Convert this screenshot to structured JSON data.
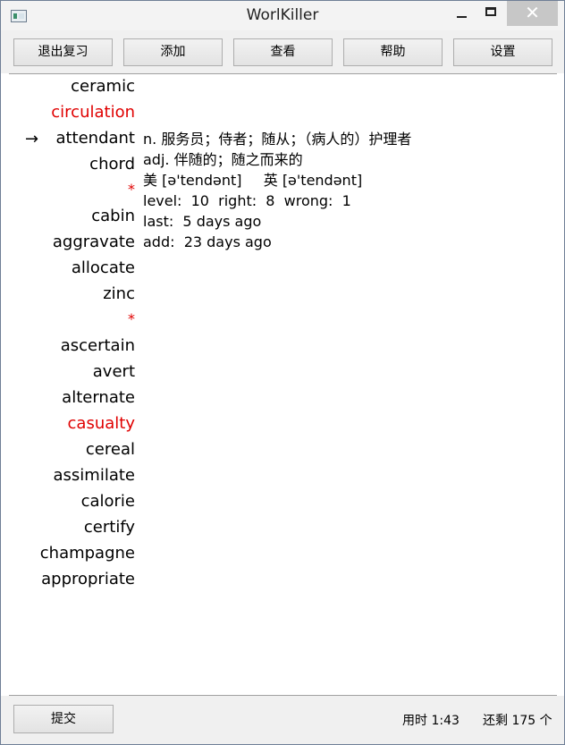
{
  "window": {
    "title": "WorlKiller",
    "close_glyph": "✕"
  },
  "toolbar": {
    "buttons": [
      {
        "label": "退出复习"
      },
      {
        "label": "添加"
      },
      {
        "label": "查看"
      },
      {
        "label": "帮助"
      },
      {
        "label": "设置"
      }
    ]
  },
  "words": [
    {
      "text": "ceramic",
      "color": "#000000"
    },
    {
      "text": "circulation",
      "color": "#e00000"
    },
    {
      "text": "attendant",
      "color": "#000000",
      "selected": true
    },
    {
      "text": "chord",
      "color": "#000000"
    },
    {
      "text": "*",
      "color": "#e00000"
    },
    {
      "text": "cabin",
      "color": "#000000"
    },
    {
      "text": "aggravate",
      "color": "#000000"
    },
    {
      "text": "allocate",
      "color": "#000000"
    },
    {
      "text": "zinc",
      "color": "#000000"
    },
    {
      "text": "*",
      "color": "#e00000"
    },
    {
      "text": "ascertain",
      "color": "#000000"
    },
    {
      "text": "avert",
      "color": "#000000"
    },
    {
      "text": "alternate",
      "color": "#000000"
    },
    {
      "text": "casualty",
      "color": "#e00000"
    },
    {
      "text": "cereal",
      "color": "#000000"
    },
    {
      "text": "assimilate",
      "color": "#000000"
    },
    {
      "text": "calorie",
      "color": "#000000"
    },
    {
      "text": "certify",
      "color": "#000000"
    },
    {
      "text": "champagne",
      "color": "#000000"
    },
    {
      "text": "appropriate",
      "color": "#000000"
    }
  ],
  "selection_arrow": "→",
  "detail": {
    "def_n": "n. 服务员；侍者；随从；（病人的）护理者",
    "def_adj": "adj. 伴随的；随之而来的",
    "phonetic_us_label": "美",
    "phonetic_us": "[ə'tendənt]",
    "phonetic_uk_label": "英",
    "phonetic_uk": "[ə'tendənt]",
    "level_label": "level:",
    "level": "10",
    "right_label": "right:",
    "right": "8",
    "wrong_label": "wrong:",
    "wrong": "1",
    "last_label": "last:",
    "last": "5 days ago",
    "add_label": "add:",
    "add": "23 days ago"
  },
  "status": {
    "submit_label": "提交",
    "elapsed": "用时 1:43",
    "remaining": "还剩 175 个"
  }
}
